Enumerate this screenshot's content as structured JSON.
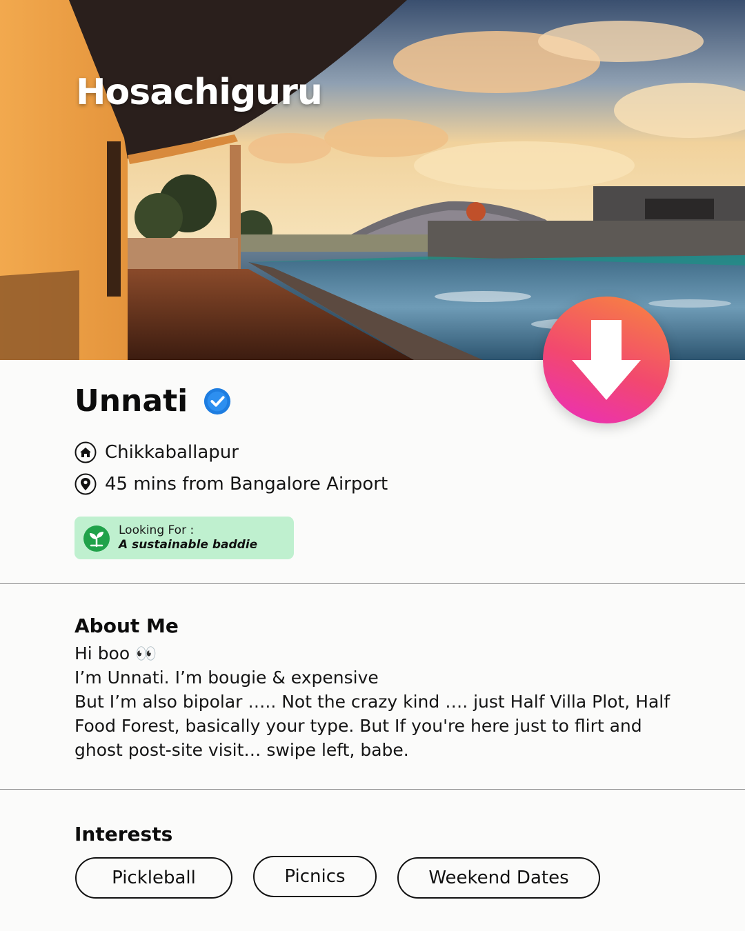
{
  "brand": {
    "name": "Hosachiguru"
  },
  "download_button": {
    "icon": "arrow-down-icon",
    "colors": [
      "#f7873e",
      "#ea2dbd"
    ]
  },
  "profile": {
    "name": "Unnati",
    "verified_icon": "verified-badge-icon",
    "location": {
      "icon": "home-icon",
      "text": "Chikkaballapur"
    },
    "distance": {
      "icon": "map-pin-icon",
      "text": "45 mins from Bangalore Airport"
    },
    "looking_for": {
      "icon": "sprout-recycle-icon",
      "label": "Looking For :",
      "value": "A sustainable baddie",
      "color": "#bff0cf"
    }
  },
  "about": {
    "title": "About Me",
    "lines": [
      "Hi boo 👀",
      "I’m Unnati. I’m bougie & expensive",
      "But I’m also  bipolar ….. Not the crazy kind …. just Half Villa Plot, Half Food Forest, basically your type. But If you're here just to flirt and ghost post-site visit… swipe left, babe."
    ]
  },
  "interests": {
    "title": "Interests",
    "items": [
      "Pickleball",
      "Picnics",
      "Weekend Dates"
    ]
  }
}
